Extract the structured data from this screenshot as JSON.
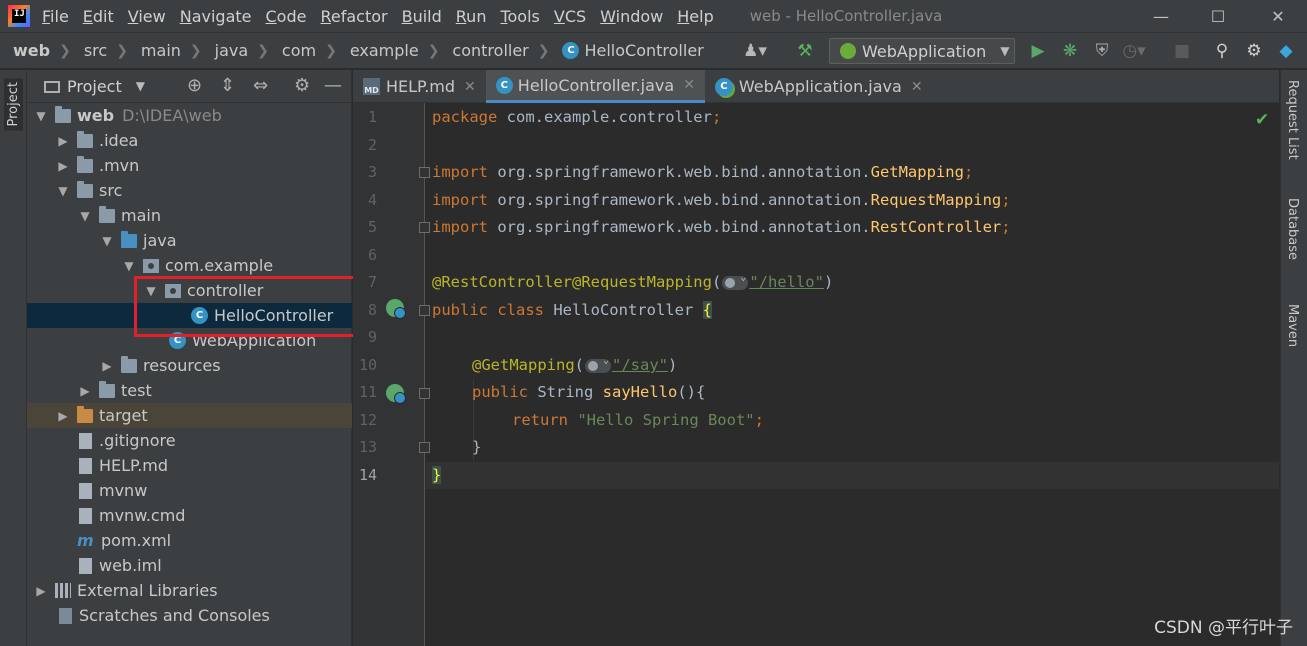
{
  "menubar": {
    "items": [
      "File",
      "Edit",
      "View",
      "Navigate",
      "Code",
      "Refactor",
      "Build",
      "Run",
      "Tools",
      "VCS",
      "Window",
      "Help"
    ],
    "window_title": "web - HelloController.java",
    "logo_text": "IJ"
  },
  "breadcrumb": {
    "items": [
      "web",
      "src",
      "main",
      "java",
      "com",
      "example",
      "controller",
      "HelloController"
    ],
    "class_badge": "C"
  },
  "toolbar": {
    "run_config": "WebApplication"
  },
  "left_stripe": {
    "project_label": "Project"
  },
  "project_panel": {
    "title": "Project",
    "tree": [
      {
        "label": "web",
        "path": "D:\\IDEA\\web"
      },
      {
        "label": ".idea"
      },
      {
        "label": ".mvn"
      },
      {
        "label": "src"
      },
      {
        "label": "main"
      },
      {
        "label": "java"
      },
      {
        "label": "com.example"
      },
      {
        "label": "controller"
      },
      {
        "label": "HelloController"
      },
      {
        "label": "WebApplication"
      },
      {
        "label": "resources"
      },
      {
        "label": "test"
      },
      {
        "label": "target"
      },
      {
        "label": ".gitignore"
      },
      {
        "label": "HELP.md"
      },
      {
        "label": "mvnw"
      },
      {
        "label": "mvnw.cmd"
      },
      {
        "label": "pom.xml"
      },
      {
        "label": "web.iml"
      },
      {
        "label": "External Libraries"
      },
      {
        "label": "Scratches and Consoles"
      }
    ]
  },
  "editor": {
    "tabs": [
      {
        "label": "HELP.md",
        "icon_text": "MD"
      },
      {
        "label": "HelloController.java",
        "icon_text": "C"
      },
      {
        "label": "WebApplication.java",
        "icon_text": "C"
      }
    ],
    "line_numbers": [
      "1",
      "2",
      "3",
      "4",
      "5",
      "6",
      "7",
      "8",
      "9",
      "10",
      "11",
      "12",
      "13",
      "14"
    ],
    "code": {
      "l1_kw": "package",
      "l1_rest": " com.example.controller",
      "l1_semi": ";",
      "import_kw": "import",
      "l3_pkg": " org.springframework.web.bind.annotation.",
      "l3_cls": "GetMapping",
      "l4_pkg": " org.springframework.web.bind.annotation.",
      "l4_cls": "RequestMapping",
      "l5_pkg": " org.springframework.web.bind.annotation.",
      "l5_cls": "RestController",
      "semi": ";",
      "l7_ann1": "@RestController",
      "l7_ann2": "@RequestMapping",
      "l7_open": "(",
      "l7_str": "\"/hello\"",
      "l7_close": ")",
      "l8_kw": "public class",
      "l8_name": " HelloController ",
      "l8_brace": "{",
      "l10_ann": "@GetMapping",
      "l10_open": "(",
      "l10_str": "\"/say\"",
      "l10_close": ")",
      "l11_kw": "public",
      "l11_type": " String ",
      "l11_fn": "sayHello",
      "l11_rest": "(){",
      "l12_kw": "return",
      "l12_str": " \"Hello Spring Boot\"",
      "l12_semi": ";",
      "l13": "}",
      "l14": "}"
    }
  },
  "right_stripe": {
    "labels": [
      "Request List",
      "Database",
      "Maven"
    ]
  },
  "watermark": "CSDN @平行叶子",
  "colors": {
    "keyword": "#cc7832",
    "annotation": "#bbb529",
    "string": "#6a8759",
    "method": "#ffc66d",
    "highlight_box": "#e0202a",
    "selection": "#0d293e"
  }
}
